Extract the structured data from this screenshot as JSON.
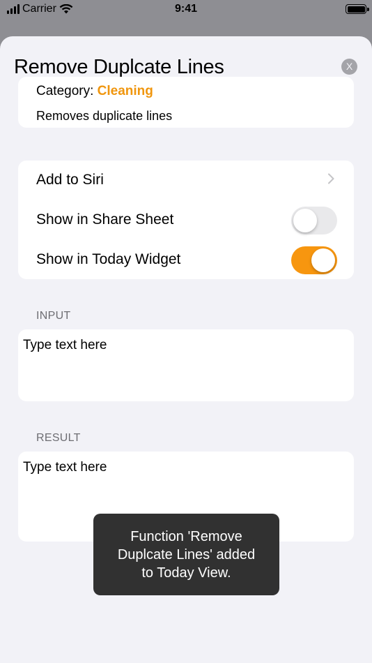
{
  "status_bar": {
    "carrier": "Carrier",
    "time": "9:41"
  },
  "sheet": {
    "title": "Remove Duplcate Lines",
    "close_label": "X"
  },
  "info": {
    "category_label": "Category:",
    "category_value": "Cleaning",
    "description": "Removes duplicate lines"
  },
  "settings": {
    "add_to_siri": "Add to Siri",
    "share_sheet": {
      "label": "Show in Share Sheet",
      "on": false
    },
    "today_widget": {
      "label": "Show in Today Widget",
      "on": true
    }
  },
  "input": {
    "header": "INPUT",
    "placeholder": "Type text here"
  },
  "result": {
    "header": "RESULT",
    "placeholder": "Type text here"
  },
  "toast": {
    "lines": [
      "Function 'Remove",
      "Duplcate Lines' added",
      "to Today View."
    ]
  },
  "colors": {
    "accent": "#f7960f",
    "category": "#f0960e",
    "background": "#f2f2f7"
  },
  "icons": {
    "signal": "cellular-signal-icon",
    "wifi": "wifi-icon",
    "battery": "battery-icon",
    "chevron": "chevron-right-icon",
    "close": "close-icon"
  }
}
